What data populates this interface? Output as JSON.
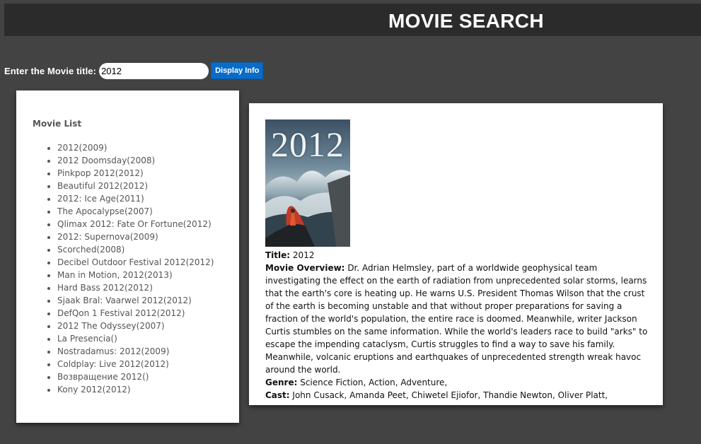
{
  "header": {
    "title": "MOVIE SEARCH"
  },
  "search": {
    "label": "Enter the Movie title:",
    "value": "2012",
    "button_label": "Display Info"
  },
  "movie_list": {
    "heading": "Movie List",
    "items": [
      "2012(2009)",
      "2012 Doomsday(2008)",
      "Pinkpop 2012(2012)",
      "Beautiful 2012(2012)",
      "2012: Ice Age(2011)",
      "The Apocalypse(2007)",
      "Qlimax 2012: Fate Or Fortune(2012)",
      "2012: Supernova(2009)",
      "Scorched(2008)",
      "Decibel Outdoor Festival 2012(2012)",
      "Man in Motion, 2012(2013)",
      "Hard Bass 2012(2012)",
      "Sjaak Bral: Vaarwel 2012(2012)",
      "DefQon 1 Festival 2012(2012)",
      "2012 The Odyssey(2007)",
      "La Presencia()",
      "Nostradamus: 2012(2009)",
      "Coldplay: Live 2012(2012)",
      "Возвращение 2012()",
      "Kony 2012(2012)"
    ]
  },
  "movie_info": {
    "poster_text": "2012",
    "title_label": "Title:",
    "title": "2012",
    "overview_label": "Movie Overview:",
    "overview": "Dr. Adrian Helmsley, part of a worldwide geophysical team investigating the effect on the earth of radiation from unprecedented solar storms, learns that the earth's core is heating up. He warns U.S. President Thomas Wilson that the crust of the earth is becoming unstable and that without proper preparations for saving a fraction of the world's population, the entire race is doomed. Meanwhile, writer Jackson Curtis stumbles on the same information. While the world's leaders race to build \"arks\" to escape the impending cataclysm, Curtis struggles to find a way to save his family. Meanwhile, volcanic eruptions and earthquakes of unprecedented strength wreak havoc around the world.",
    "genre_label": "Genre:",
    "genre": "Science Fiction, Action, Adventure,",
    "cast_label": "Cast:",
    "cast": "John Cusack, Amanda Peet, Chiwetel Ejiofor, Thandie Newton, Oliver Platt,"
  },
  "colors": {
    "page_background": "#434343",
    "header_background": "#2b2b2c",
    "button_background": "#0a6cc9",
    "list_text": "#555555"
  }
}
